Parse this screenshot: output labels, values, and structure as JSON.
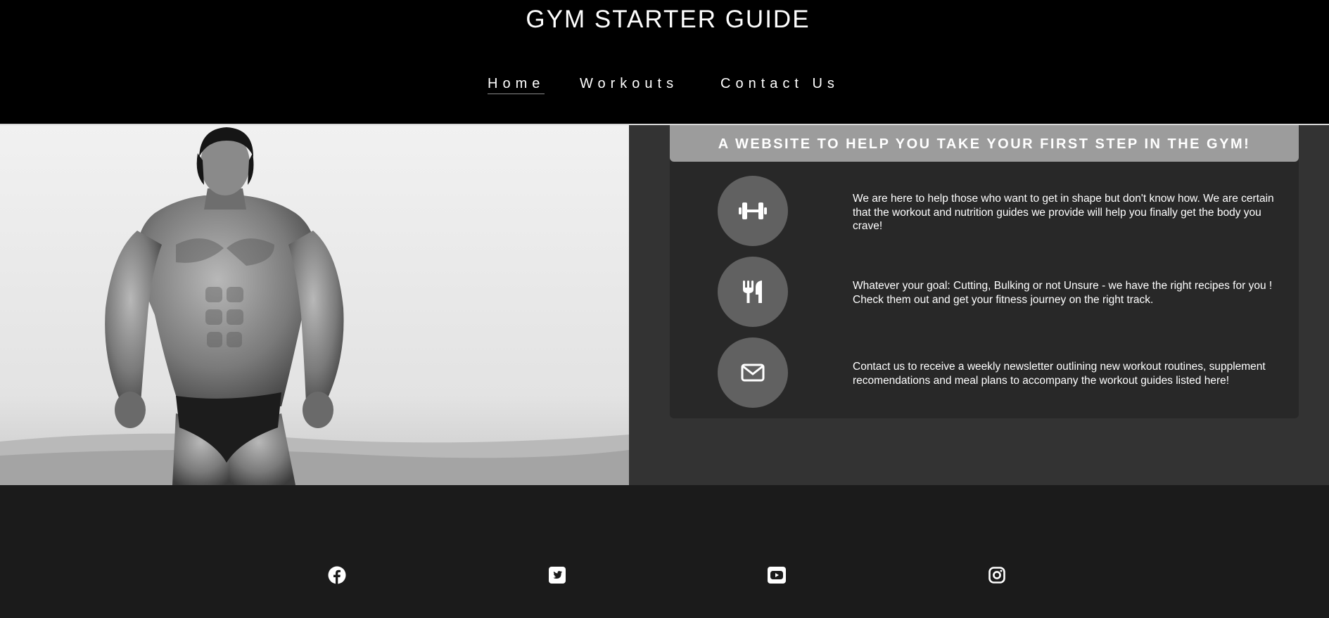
{
  "header": {
    "site_title": "GYM STARTER GUIDE",
    "nav": [
      {
        "label": "Home",
        "active": true
      },
      {
        "label": "Workouts",
        "active": false
      },
      {
        "label": "Contact Us",
        "active": false
      }
    ]
  },
  "hero": {
    "image": "bodybuilder-photo"
  },
  "intro": {
    "heading": "A WEBSITE TO HELP YOU TAKE YOUR FIRST STEP IN THE GYM!",
    "features": [
      {
        "icon": "dumbbell-icon",
        "text": "We are here to help those who want to get in shape but don't know how. We are certain that the workout and nutrition guides we provide will help you finally get the body you crave!"
      },
      {
        "icon": "utensils-icon",
        "text": "Whatever your goal: Cutting, Bulking or not Unsure - we have the right recipes for you ! Check them out and get your fitness journey on the right track."
      },
      {
        "icon": "envelope-icon",
        "text": "Contact us to receive a weekly newsletter outlining new workout routines, supplement recomendations and meal plans to accompany the workout guides listed here!"
      }
    ]
  },
  "footer": {
    "social": [
      "facebook-icon",
      "twitter-icon",
      "youtube-icon",
      "instagram-icon"
    ]
  },
  "colors": {
    "header_bg": "#000000",
    "panel_bg": "#333333",
    "card_bg": "#282828",
    "heading_bar": "#9c9c9c",
    "icon_circle": "#616161",
    "footer_bg": "#1b1b1b"
  }
}
